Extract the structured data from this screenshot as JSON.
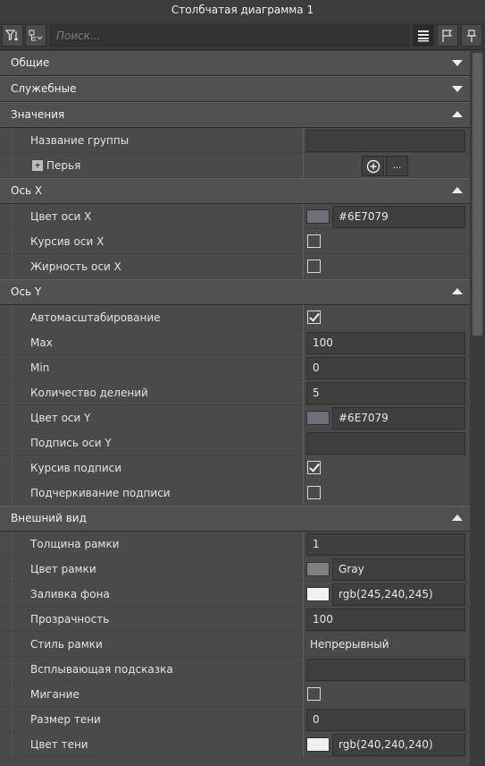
{
  "window": {
    "title": "Столбчатая диаграмма 1"
  },
  "toolbar": {
    "search_placeholder": "Поиск...",
    "filter_icon": "filter-sort-icon",
    "expand_icon": "collapse-tree-icon",
    "list_icon": "list-view-icon",
    "flag_icon": "flag-icon",
    "pin_icon": "pin-icon"
  },
  "sections": {
    "general": {
      "label": "Общие"
    },
    "service": {
      "label": "Служебные"
    },
    "values": {
      "label": "Значения",
      "group_name": {
        "label": "Название группы",
        "value": ""
      },
      "pens": {
        "label": "Перья",
        "add_icon": "add-circle-icon",
        "more_label": "..."
      }
    },
    "axis_x": {
      "label": "Ось X",
      "color": {
        "label": "Цвет оси X",
        "value": "#6E7079",
        "swatch": "#6e7079"
      },
      "italic": {
        "label": "Курсив оси X",
        "checked": false
      },
      "bold": {
        "label": "Жирность оси X",
        "checked": false
      }
    },
    "axis_y": {
      "label": "Ось Y",
      "autoscale": {
        "label": "Автомасштабирование",
        "checked": true
      },
      "max": {
        "label": "Max",
        "value": "100"
      },
      "min": {
        "label": "Min",
        "value": "0"
      },
      "divisions": {
        "label": "Количество делений",
        "value": "5"
      },
      "color": {
        "label": "Цвет оси Y",
        "value": "#6E7079",
        "swatch": "#6e7079"
      },
      "caption": {
        "label": "Подпись оси Y",
        "value": ""
      },
      "caption_italic": {
        "label": "Курсив подписи",
        "checked": true
      },
      "caption_underline": {
        "label": "Подчеркивание подписи",
        "checked": false
      }
    },
    "appearance": {
      "label": "Внешний вид",
      "border_width": {
        "label": "Толщина рамки",
        "value": "1"
      },
      "border_color": {
        "label": "Цвет рамки",
        "value": "Gray",
        "swatch": "#808080"
      },
      "background": {
        "label": "Заливка фона",
        "value": "rgb(245,240,245)",
        "swatch": "#f5f0f5"
      },
      "opacity": {
        "label": "Прозрачность",
        "value": "100"
      },
      "border_style": {
        "label": "Стиль рамки",
        "value": "Непрерывный"
      },
      "tooltip": {
        "label": "Всплывающая подсказка",
        "value": ""
      },
      "blink": {
        "label": "Мигание",
        "checked": false
      },
      "shadow_size": {
        "label": "Размер тени",
        "value": "0"
      },
      "shadow_color": {
        "label": "Цвет тени",
        "value": "rgb(240,240,240)",
        "swatch": "#f0f0f0"
      }
    }
  }
}
